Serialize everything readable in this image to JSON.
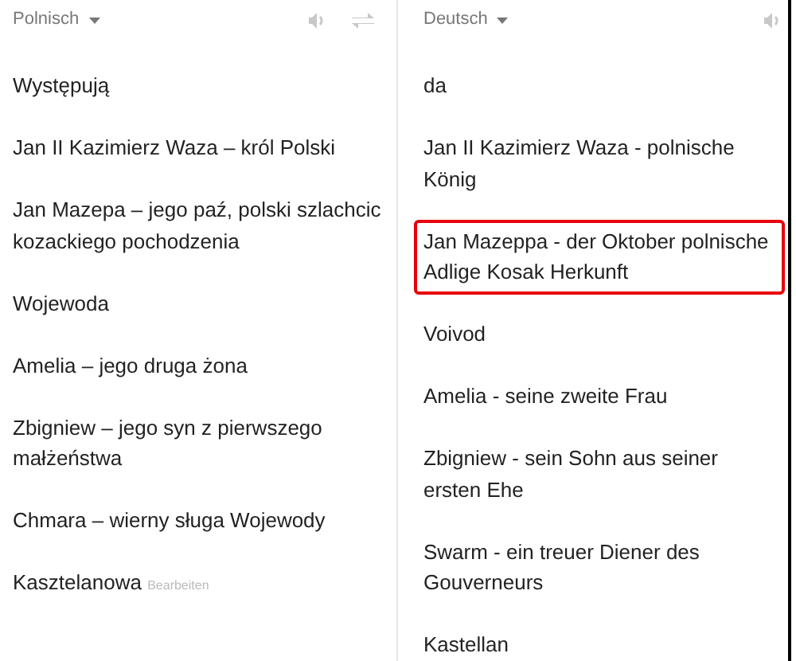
{
  "source": {
    "language": "Polnisch",
    "lines": [
      {
        "text": "Występują"
      },
      {
        "text": "Jan II Kazimierz Waza – król Polski"
      },
      {
        "text": "Jan Mazepa – jego paź, polski szlachcic kozackiego pochodzenia"
      },
      {
        "text": "Wojewoda"
      },
      {
        "text": "Amelia – jego druga żona"
      },
      {
        "text": "Zbigniew – jego syn z pierwszego małżeństwa"
      },
      {
        "text": "Chmara – wierny sługa Wojewody"
      },
      {
        "text": "Kasztelanowa",
        "edit_link": "Bearbeiten"
      }
    ]
  },
  "target": {
    "language": "Deutsch",
    "lines": [
      {
        "text": "da",
        "highlighted": false
      },
      {
        "text": "Jan II Kazimierz Waza - polnische König",
        "highlighted": false
      },
      {
        "text": "Jan Mazeppa - der Oktober polnische Adlige Kosak Herkunft",
        "highlighted": true
      },
      {
        "text": "Voivod",
        "highlighted": false
      },
      {
        "text": "Amelia - seine zweite Frau",
        "highlighted": false
      },
      {
        "text": "Zbigniew - sein Sohn aus seiner ersten Ehe",
        "highlighted": false
      },
      {
        "text": "Swarm - ein treuer Diener des Gouverneurs",
        "highlighted": false
      },
      {
        "text": "Kastellan",
        "highlighted": false
      }
    ]
  }
}
